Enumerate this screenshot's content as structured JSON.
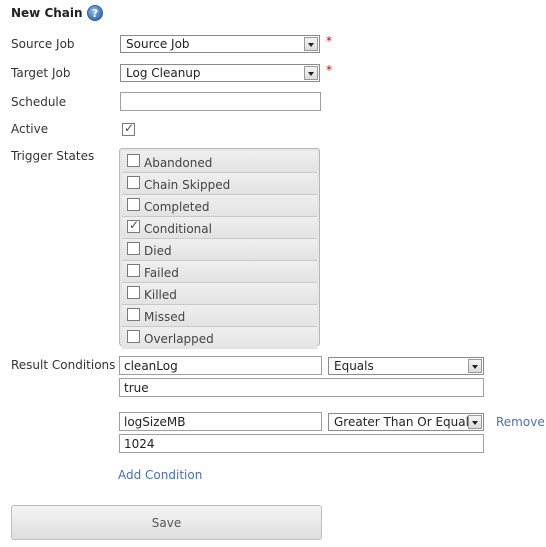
{
  "header": {
    "title": "New Chain",
    "help_icon": "help-icon"
  },
  "form": {
    "source_job": {
      "label": "Source Job",
      "value": "Source Job",
      "required_mark": "*"
    },
    "target_job": {
      "label": "Target Job",
      "value": "Log Cleanup",
      "required_mark": "*"
    },
    "schedule": {
      "label": "Schedule",
      "value": ""
    },
    "active": {
      "label": "Active",
      "checked": true
    },
    "trigger_states": {
      "label": "Trigger States",
      "items": [
        {
          "label": "Abandoned",
          "checked": false
        },
        {
          "label": "Chain Skipped",
          "checked": false
        },
        {
          "label": "Completed",
          "checked": false
        },
        {
          "label": "Conditional",
          "checked": true
        },
        {
          "label": "Died",
          "checked": false
        },
        {
          "label": "Failed",
          "checked": false
        },
        {
          "label": "Killed",
          "checked": false
        },
        {
          "label": "Missed",
          "checked": false
        },
        {
          "label": "Overlapped",
          "checked": false
        }
      ]
    },
    "result_conditions": {
      "label": "Result Conditions",
      "conditions": [
        {
          "field": "cleanLog",
          "operator": "Equals",
          "value": "true"
        },
        {
          "field": "logSizeMB",
          "operator": "Greater Than Or Equal",
          "value": "1024",
          "remove_label": "Remove"
        }
      ],
      "add_label": "Add Condition"
    },
    "save_label": "Save"
  },
  "colors": {
    "required": "#cc0000",
    "link": "#4a6fb0"
  }
}
